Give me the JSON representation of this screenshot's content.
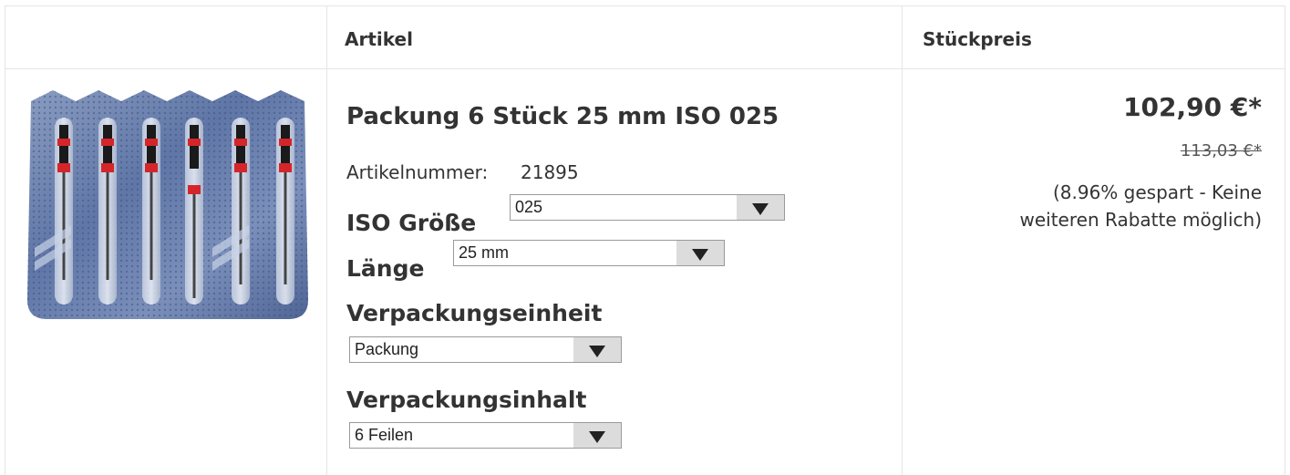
{
  "table": {
    "header": {
      "artikel": "Artikel",
      "stueckpreis": "Stückpreis"
    }
  },
  "product": {
    "title": "Packung 6 Stück 25 mm ISO 025",
    "artikelnummer_label": "Artikelnummer:",
    "artikelnummer": "21895",
    "image_icon": "endodontic-files-blister-pack-image"
  },
  "options": {
    "iso": {
      "label": "ISO Größe",
      "value": "025"
    },
    "laenge": {
      "label": "Länge",
      "value": "25 mm"
    },
    "verpackungseinheit": {
      "label": "Verpackungseinheit",
      "value": "Packung"
    },
    "verpackungsinhalt": {
      "label": "Verpackungsinhalt",
      "value": "6 Feilen"
    }
  },
  "pricing": {
    "price": "102,90 €*",
    "old_price": "113,03 €*",
    "saving_line1": "(8.96% gespart - Keine",
    "saving_line2": "weiteren Rabatte möglich)"
  },
  "colors": {
    "border": "#e5e5e5",
    "text": "#333333",
    "select_button": "#dcdcdc"
  }
}
